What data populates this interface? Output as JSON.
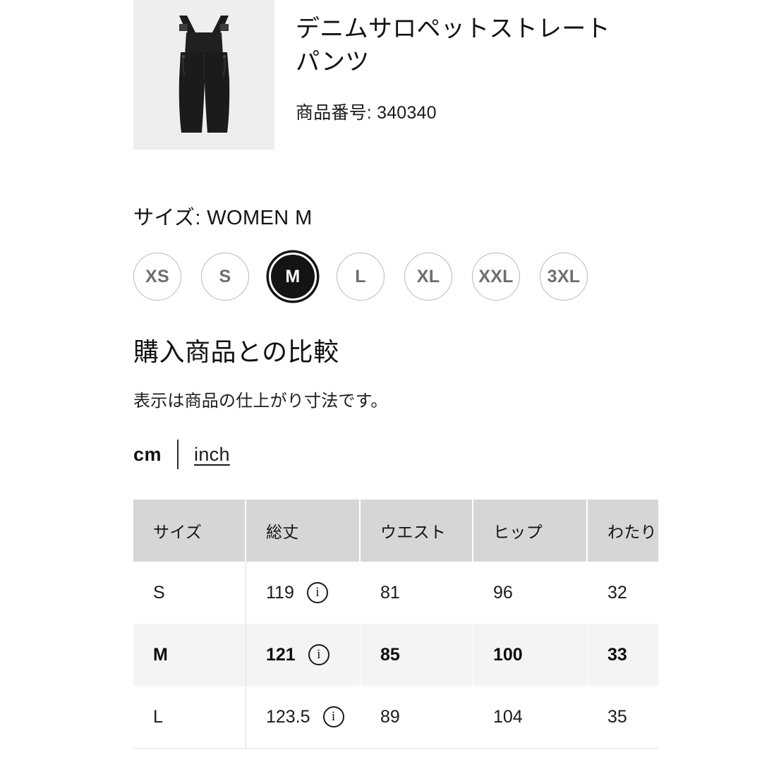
{
  "product": {
    "title": "デニムサロペットストレートパンツ",
    "code_label": "商品番号: 340340",
    "image_alt": "black-denim-overalls"
  },
  "size_selector": {
    "label": "サイズ: WOMEN M",
    "options": [
      "XS",
      "S",
      "M",
      "L",
      "XL",
      "XXL",
      "3XL"
    ],
    "selected": "M"
  },
  "comparison": {
    "heading": "購入商品との比較",
    "note": "表示は商品の仕上がり寸法です。"
  },
  "units": {
    "active": "cm",
    "alternate": "inch"
  },
  "size_table": {
    "columns": [
      "サイズ",
      "総丈",
      "ウエスト",
      "ヒップ",
      "わたり"
    ],
    "rows": [
      {
        "size": "S",
        "length": "119",
        "waist": "81",
        "hip": "96",
        "thigh": "32",
        "highlight": false,
        "info": "i"
      },
      {
        "size": "M",
        "length": "121",
        "waist": "85",
        "hip": "100",
        "thigh": "33",
        "highlight": true,
        "info": "i"
      },
      {
        "size": "L",
        "length": "123.5",
        "waist": "89",
        "hip": "104",
        "thigh": "35",
        "highlight": false,
        "info": "i"
      }
    ]
  },
  "colors": {
    "accent": "#141414",
    "header_bg": "#d6d6d6",
    "highlight_bg": "#f4f4f4",
    "thumb_bg": "#eeeeee",
    "muted_text": "#6e6e6e"
  }
}
